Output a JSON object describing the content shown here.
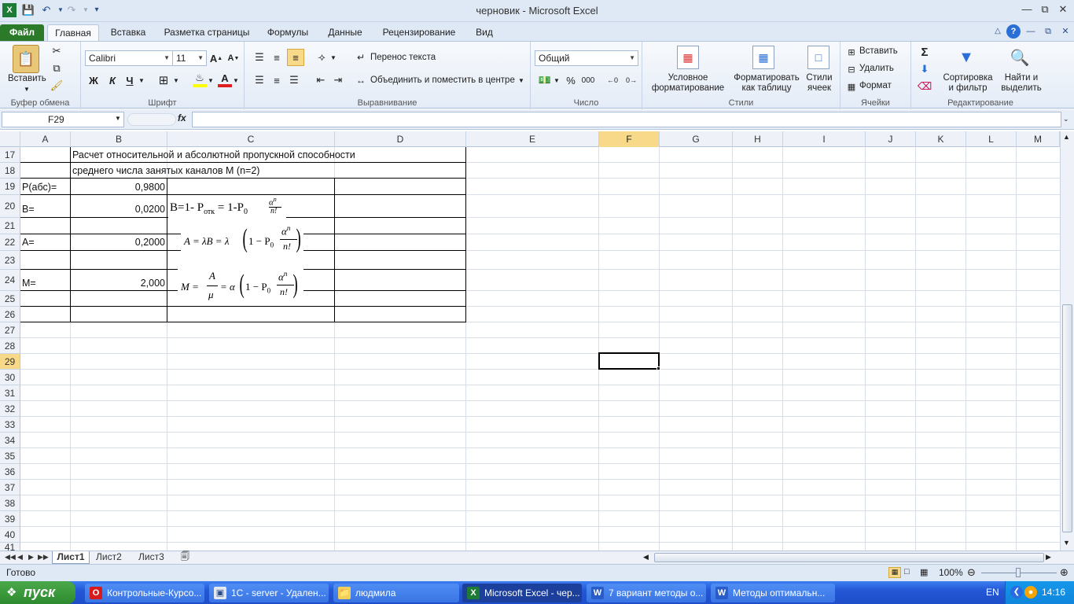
{
  "window": {
    "title": "черновик - Microsoft Excel"
  },
  "tabs": [
    "Файл",
    "Главная",
    "Вставка",
    "Разметка страницы",
    "Формулы",
    "Данные",
    "Рецензирование",
    "Вид"
  ],
  "ribbon": {
    "clipboard": {
      "paste": "Вставить",
      "label": "Буфер обмена"
    },
    "font": {
      "name": "Calibri",
      "size": "11",
      "bold": "Ж",
      "italic": "К",
      "underline": "Ч",
      "label": "Шрифт"
    },
    "alignment": {
      "wrap": "Перенос текста",
      "merge": "Объединить и поместить в центре",
      "label": "Выравнивание"
    },
    "number": {
      "format": "Общий",
      "percent": "%",
      "thousands": "000",
      "label": "Число"
    },
    "styles": {
      "conditional": [
        "Условное",
        "форматирование"
      ],
      "table": [
        "Форматировать",
        "как таблицу"
      ],
      "cell": [
        "Стили",
        "ячеек"
      ],
      "label": "Стили"
    },
    "cells": {
      "insert": "Вставить",
      "delete": "Удалить",
      "format": "Формат",
      "label": "Ячейки"
    },
    "editing": {
      "sort": [
        "Сортировка",
        "и фильтр"
      ],
      "find": [
        "Найти и",
        "выделить"
      ],
      "label": "Редактирование"
    }
  },
  "formula_bar": {
    "name_box": "F29",
    "fx": "fx",
    "formula": ""
  },
  "columns": [
    "A",
    "B",
    "C",
    "D",
    "E",
    "F",
    "G",
    "H",
    "I",
    "J",
    "K",
    "L",
    "M"
  ],
  "selected_column": "F",
  "rows": [
    "17",
    "18",
    "19",
    "20",
    "21",
    "22",
    "23",
    "24",
    "25",
    "26",
    "27",
    "28",
    "29",
    "30",
    "31",
    "32",
    "33",
    "34",
    "35",
    "36",
    "37",
    "38",
    "39",
    "40",
    "41"
  ],
  "selected_row": "29",
  "cells": {
    "c17": "Расчет относительной и абсолютной пропускной способности",
    "c18": "среднего числа занятых каналов М (n=2)",
    "a19": "Р(абс)=",
    "b19": "0,9800",
    "a20": "B=",
    "b20": "0,0200",
    "a22": "А=",
    "b22": "0,2000",
    "a24": "М=",
    "b24": "2,000"
  },
  "formulas": {
    "f1_lhs": "B=1- P",
    "f1_sub": "отк",
    "f1_mid": " = 1-P",
    "f1_zero": "0",
    "f1_num": "α",
    "f1_exp": "n",
    "f1_den": "n!",
    "f2_lhs": "A = λB = λ",
    "f2_p": "1 − P",
    "f2_zero": "0",
    "f2_num": "α",
    "f2_exp": "n",
    "f2_den": "n!",
    "f3_lhs": "M =",
    "f3_fnum": "A",
    "f3_fden": "μ",
    "f3_eq": "= α",
    "f3_p": "1 − P",
    "f3_zero": "0",
    "f3_num": "α",
    "f3_exp": "n",
    "f3_den": "n!"
  },
  "sheets": [
    "Лист1",
    "Лист2",
    "Лист3"
  ],
  "status": {
    "ready": "Готово",
    "zoom": "100%"
  },
  "taskbar": {
    "start": "пуск",
    "items": [
      "Контрольные-Курсо...",
      "1С - server - Удален...",
      "людмила",
      "Microsoft Excel - чер...",
      "7 вариант методы о...",
      "Методы оптимальн..."
    ],
    "lang": "EN",
    "clock": "14:16"
  }
}
